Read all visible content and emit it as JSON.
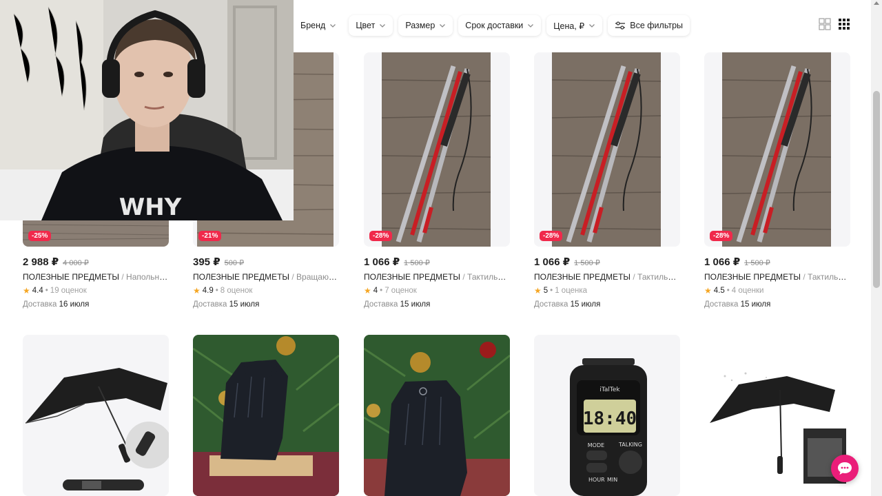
{
  "filters": [
    {
      "label": "Бренд"
    },
    {
      "label": "Цвет"
    },
    {
      "label": "Размер"
    },
    {
      "label": "Срок доставки"
    },
    {
      "label": "Цена, ₽"
    }
  ],
  "all_filters_label": "Все фильтры",
  "view_options": [
    "grid-large-icon",
    "grid-small-icon"
  ],
  "row1": [
    {
      "discount": "-25%",
      "price": "2 988 ₽",
      "old_price": "4 000 ₽",
      "brand": "ПОЛЕЗНЫЕ ПРЕДМЕТЫ",
      "name": "Напольные ...",
      "rating": "4.4",
      "reviews": "19 оценок",
      "delivery_label": "Доставка",
      "delivery_date": "16 июля"
    },
    {
      "discount": "-21%",
      "price": "395 ₽",
      "old_price": "500 ₽",
      "brand": "ПОЛЕЗНЫЕ ПРЕДМЕТЫ",
      "name": "Вращающи...",
      "rating": "4.9",
      "reviews": "8 оценок",
      "delivery_label": "Доставка",
      "delivery_date": "15 июля"
    },
    {
      "discount": "-28%",
      "price": "1 066 ₽",
      "old_price": "1 500 ₽",
      "brand": "ПОЛЕЗНЫЕ ПРЕДМЕТЫ",
      "name": "Тактильная ...",
      "rating": "4",
      "reviews": "7 оценок",
      "delivery_label": "Доставка",
      "delivery_date": "15 июля"
    },
    {
      "discount": "-28%",
      "price": "1 066 ₽",
      "old_price": "1 500 ₽",
      "brand": "ПОЛЕЗНЫЕ ПРЕДМЕТЫ",
      "name": "Тактильная ...",
      "rating": "5",
      "reviews": "1 оценка",
      "delivery_label": "Доставка",
      "delivery_date": "15 июля"
    },
    {
      "discount": "-28%",
      "price": "1 066 ₽",
      "old_price": "1 500 ₽",
      "brand": "ПОЛЕЗНЫЕ ПРЕДМЕТЫ",
      "name": "Тактильная ...",
      "rating": "4.5",
      "reviews": "4 оценки",
      "delivery_label": "Доставка",
      "delivery_date": "15 июля"
    }
  ],
  "watch_display": "18:40",
  "watch_brand": "iTalTek",
  "watch_mode": "MODE",
  "watch_talking": "TALKING",
  "watch_hour": "HOUR",
  "watch_min": "MIN",
  "webcam_shirt_text": "WHY",
  "colors": {
    "discount": "#f0294b",
    "accent": "#ea1e79",
    "star": "#f5a623"
  }
}
